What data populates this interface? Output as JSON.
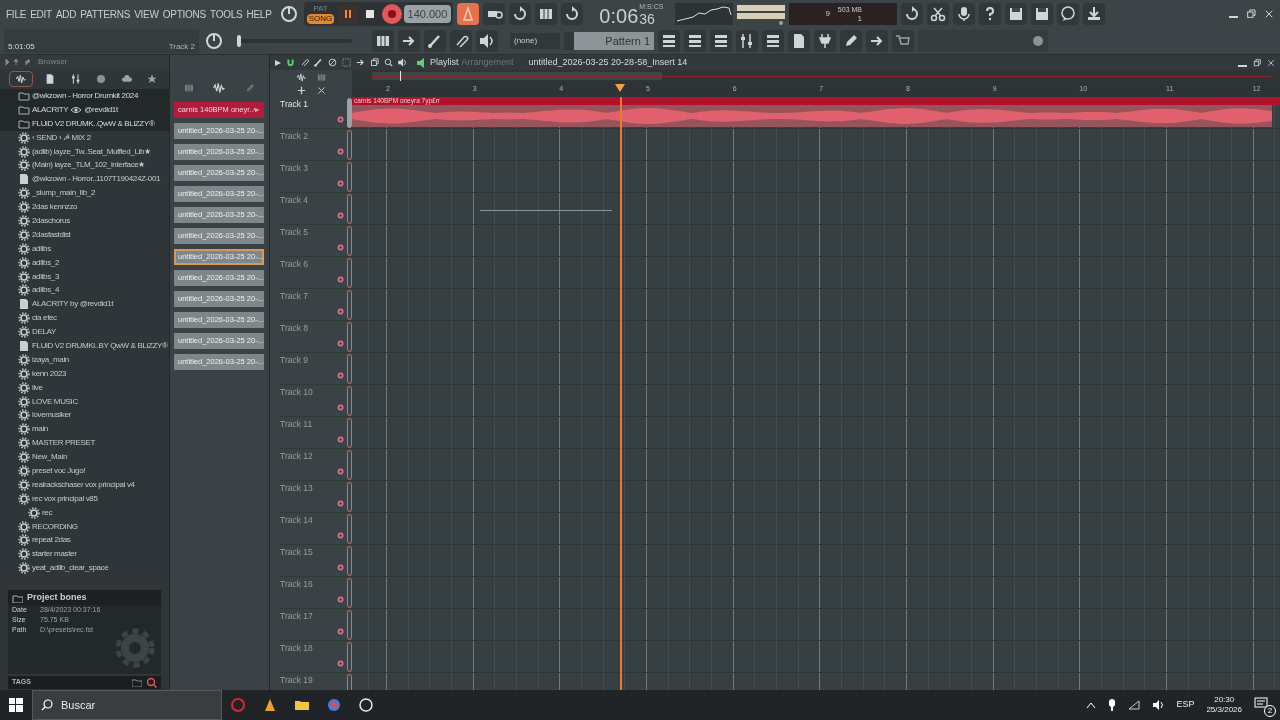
{
  "menu": [
    "FILE",
    "EDIT",
    "ADD",
    "PATTERNS",
    "VIEW",
    "OPTIONS",
    "TOOLS",
    "HELP"
  ],
  "transport": {
    "pat_label": "PAT",
    "song_label": "SONG",
    "song_mode": true,
    "playing": true,
    "tempo": "140.000"
  },
  "time": {
    "value": "0:06",
    "sub": "36",
    "unit": "M:S:CS"
  },
  "monitor": {
    "voices": "9",
    "memory": "503 MB",
    "polyphony": "1"
  },
  "hint": {
    "position": "5:01:05",
    "target": "Track 2"
  },
  "pattern": {
    "preset": "(none)",
    "name": "Pattern 1"
  },
  "pitch": {
    "level": 0
  },
  "browser": {
    "title": "Browser",
    "items": [
      {
        "label": "@wkzown - Horror Drumkit 2024",
        "kind": "folder"
      },
      {
        "label": "ALACRITY",
        "suffix": "@revdid1t",
        "kind": "folder"
      },
      {
        "label": "FLUiD V2 DRUMK..QwW & BLiZZY®",
        "kind": "folder"
      },
      {
        "label": "‹ SEND › ☭ MIX 2",
        "kind": "preset"
      },
      {
        "label": "(adlib) iayze_Tw..Seat_Muffled_Lib★",
        "kind": "preset"
      },
      {
        "label": "(Main) iayze_TLM_102_interface★",
        "kind": "preset"
      },
      {
        "label": "@wkzown - Horror..1107T190424Z-001",
        "kind": "file"
      },
      {
        "label": "_slump_main_lib_2",
        "kind": "preset"
      },
      {
        "label": "2das kennzzo",
        "kind": "preset"
      },
      {
        "label": "2daschorus",
        "kind": "preset"
      },
      {
        "label": "2dasfastdist",
        "kind": "preset"
      },
      {
        "label": "adlibs",
        "kind": "preset"
      },
      {
        "label": "adlibs_2",
        "kind": "preset"
      },
      {
        "label": "adlibs_3",
        "kind": "preset"
      },
      {
        "label": "adlibs_4",
        "kind": "preset"
      },
      {
        "label": "ALACRITY by @revdid1t",
        "kind": "file"
      },
      {
        "label": "cla efec",
        "kind": "preset"
      },
      {
        "label": "DELAY",
        "kind": "preset"
      },
      {
        "label": "FLUiD V2 DRUMKi..BY QwW & BLiZZY®",
        "kind": "file"
      },
      {
        "label": "izaya_main",
        "kind": "preset"
      },
      {
        "label": "kenn 2023",
        "kind": "preset"
      },
      {
        "label": "live",
        "kind": "preset"
      },
      {
        "label": "LOVE MUSIC",
        "kind": "preset"
      },
      {
        "label": "lovemusiker",
        "kind": "preset"
      },
      {
        "label": "main",
        "kind": "preset"
      },
      {
        "label": "MASTER PRESET",
        "kind": "preset"
      },
      {
        "label": "New_Main",
        "kind": "preset"
      },
      {
        "label": "preset voc Jugo!",
        "kind": "preset"
      },
      {
        "label": "realrackschaser vox principal v4",
        "kind": "preset"
      },
      {
        "label": "rec vox principal v85",
        "kind": "preset",
        "children": [
          {
            "label": "rec",
            "kind": "preset"
          }
        ]
      },
      {
        "label": "RECORDING",
        "kind": "preset"
      },
      {
        "label": "repeat 2das",
        "kind": "preset"
      },
      {
        "label": "starter master",
        "kind": "preset"
      },
      {
        "label": "yeat_adlib_clear_space",
        "kind": "preset"
      }
    ],
    "info": {
      "title": "Project bones",
      "fields": [
        {
          "label": "Date",
          "value": "28/4/2023 00:37:16"
        },
        {
          "label": "Size",
          "value": "75.75 KB"
        },
        {
          "label": "Path",
          "value": "D:\\presets\\rec.fst"
        }
      ]
    },
    "tags_label": "TAGS"
  },
  "channels": [
    {
      "label": "carnis 140BPM oneyr..",
      "kind": "audio",
      "selected": false
    },
    {
      "label": "untitled_2026-03-25 20-...",
      "kind": "pattern",
      "selected": false
    },
    {
      "label": "untitled_2026-03-25 20-...",
      "kind": "pattern",
      "selected": false
    },
    {
      "label": "untitled_2026-03-25 20-...",
      "kind": "pattern",
      "selected": false
    },
    {
      "label": "untitled_2026-03-25 20-...",
      "kind": "pattern",
      "selected": false
    },
    {
      "label": "untitled_2026-03-25 20-...",
      "kind": "pattern",
      "selected": false
    },
    {
      "label": "untitled_2026-03-25 20-...",
      "kind": "pattern",
      "selected": false
    },
    {
      "label": "untitled_2026-03-25 20-...",
      "kind": "pattern",
      "selected": true
    },
    {
      "label": "untitled_2026-03-25 20-...",
      "kind": "pattern",
      "selected": false
    },
    {
      "label": "untitled_2026-03-25 20-...",
      "kind": "pattern",
      "selected": false
    },
    {
      "label": "untitled_2026-03-25 20-...",
      "kind": "pattern",
      "selected": false
    },
    {
      "label": "untitled_2026-03-25 20-...",
      "kind": "pattern",
      "selected": false
    },
    {
      "label": "untitled_2026-03-25 20-...",
      "kind": "pattern",
      "selected": false
    }
  ],
  "playlist": {
    "title": "Playlist",
    "subtitle": "Arrangement",
    "name": "untitled_2026-03-25 20-28-58_Insert 14",
    "ruler": [
      "2",
      "3",
      "4",
      "5",
      "6",
      "7",
      "8",
      "9",
      "10",
      "11",
      "12"
    ],
    "tracks": [
      {
        "label": "Track 1",
        "clip": "carnis 140BPM oneyra 7yp£rr"
      },
      {
        "label": "Track 2"
      },
      {
        "label": "Track 3"
      },
      {
        "label": "Track 4"
      },
      {
        "label": "Track 5"
      },
      {
        "label": "Track 6"
      },
      {
        "label": "Track 7"
      },
      {
        "label": "Track 8"
      },
      {
        "label": "Track 9"
      },
      {
        "label": "Track 10"
      },
      {
        "label": "Track 11"
      },
      {
        "label": "Track 12"
      },
      {
        "label": "Track 13"
      },
      {
        "label": "Track 14"
      },
      {
        "label": "Track 15"
      },
      {
        "label": "Track 16"
      },
      {
        "label": "Track 17"
      },
      {
        "label": "Track 18"
      },
      {
        "label": "Track 19"
      }
    ]
  },
  "taskbar": {
    "search": "Buscar",
    "language": "ESP",
    "time": "20:30",
    "date": "25/3/2026",
    "notifications": "2"
  }
}
